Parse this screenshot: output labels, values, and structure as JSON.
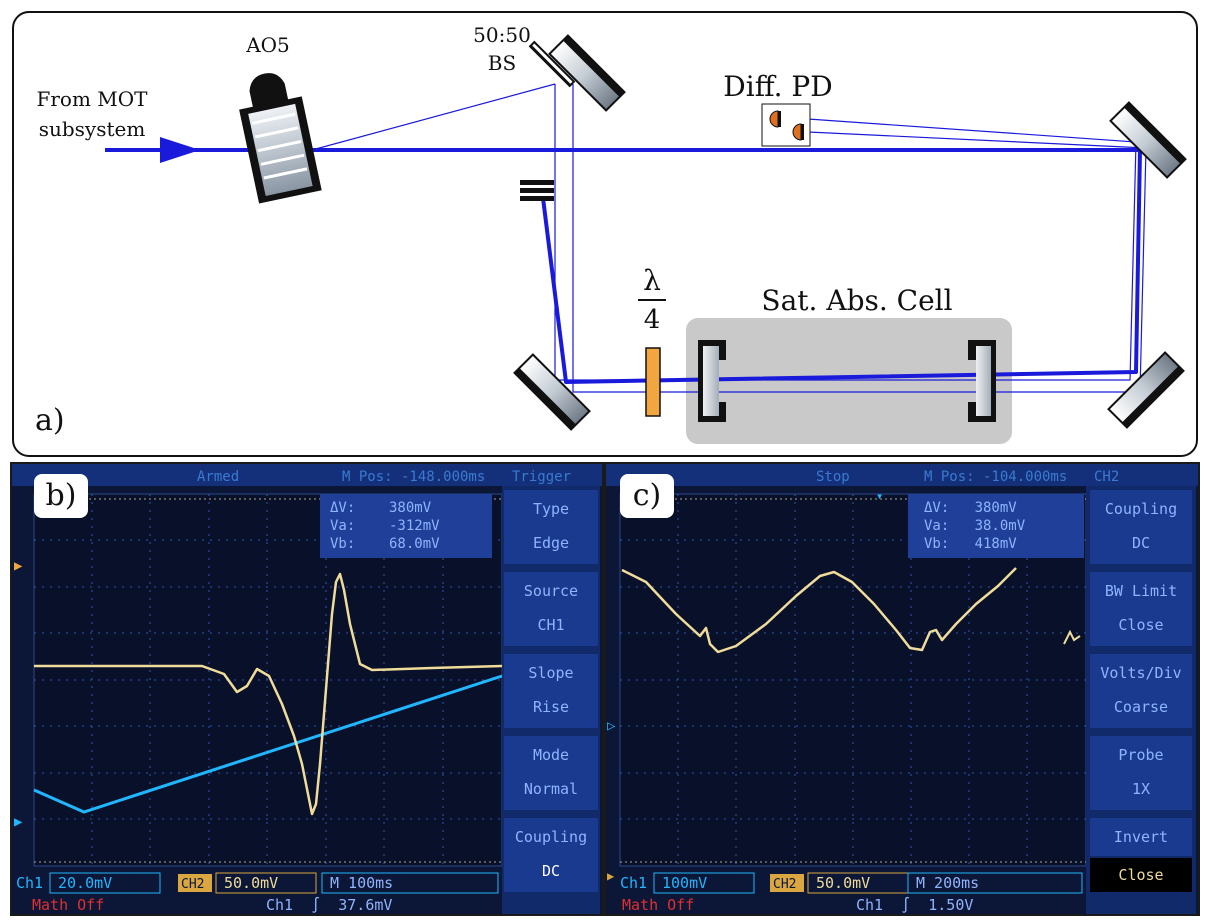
{
  "panel_a": {
    "label": "a)",
    "source_label_line1": "From MOT",
    "source_label_line2": "subsystem",
    "aom_label": "AO5",
    "bs_label_line1": "50:50",
    "bs_label_line2": "BS",
    "pd_label": "Diff. PD",
    "cell_label": "Sat. Abs. Cell",
    "waveplate_numerator": "λ",
    "waveplate_denominator": "4",
    "colors": {
      "beam": "#1a1adb",
      "waveplate": "#f2a640",
      "cell": "#c9c9c9",
      "pd": "#e07020"
    }
  },
  "panel_b": {
    "label": "b)",
    "top_status": "Armed",
    "top_pos": "M Pos: -148.000ms",
    "top_mode": "Trigger",
    "cursor_dv": "ΔV:    380mV",
    "cursor_va": "Va:    -312mV",
    "cursor_vb": "Vb:    68.0mV",
    "menu": [
      {
        "title": "Type",
        "value": "Edge"
      },
      {
        "title": "Source",
        "value": "CH1"
      },
      {
        "title": "Slope",
        "value": "Rise"
      },
      {
        "title": "Mode",
        "value": "Normal"
      },
      {
        "title": "Coupling",
        "value": "DC"
      }
    ],
    "ch1_label": "Ch1",
    "ch1_scale": "20.0mV",
    "ch2_label": "CH2",
    "ch2_scale": "50.0mV",
    "time_scale": "M 100ms",
    "math_status": "Math Off",
    "trigger_info": "Ch1  ∫  37.6mV"
  },
  "panel_c": {
    "label": "c)",
    "top_status": "Stop",
    "top_pos": "M Pos: -104.000ms",
    "top_mode": "CH2",
    "cursor_dv": "ΔV:   380mV",
    "cursor_va": "Va:   38.0mV",
    "cursor_vb": "Vb:   418mV",
    "menu": [
      {
        "title": "Coupling",
        "value": "DC"
      },
      {
        "title": "BW Limit",
        "value": "Close"
      },
      {
        "title": "Volts/Div",
        "value": "Coarse"
      },
      {
        "title": "Probe",
        "value": "1X"
      },
      {
        "title": "Invert",
        "value": "Close"
      }
    ],
    "ch1_label": "Ch1",
    "ch1_scale": "100mV",
    "ch2_label": "CH2",
    "ch2_scale": "50.0mV",
    "time_scale": "M 200ms",
    "math_status": "Math Off",
    "trigger_info": "Ch1  ∫  1.50V"
  }
}
